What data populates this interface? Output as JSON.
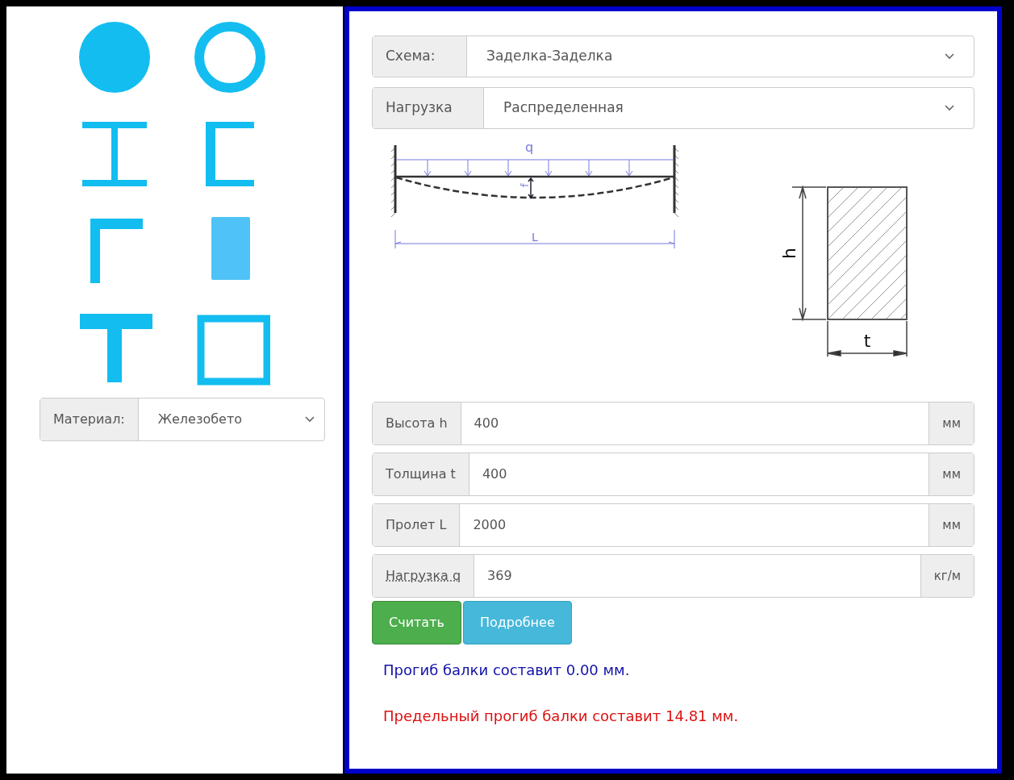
{
  "shapes": [
    {
      "kind": "circle",
      "selected": false
    },
    {
      "kind": "ring",
      "selected": false
    },
    {
      "kind": "i-beam",
      "selected": false
    },
    {
      "kind": "channel",
      "selected": false
    },
    {
      "kind": "angle",
      "selected": false
    },
    {
      "kind": "rectangle",
      "selected": true
    },
    {
      "kind": "tee",
      "selected": false
    },
    {
      "kind": "box",
      "selected": false
    }
  ],
  "material": {
    "label": "Материал:",
    "value": "Железобето"
  },
  "selects": [
    {
      "label": "Схема:",
      "value": "Заделка-Заделка"
    },
    {
      "label": "Нагрузка",
      "value": "Распределенная"
    }
  ],
  "beam_diagram": {
    "load": "q",
    "deflection": "f",
    "span": "L"
  },
  "section_diagram": {
    "height": "h",
    "thickness": "t"
  },
  "inputs": [
    {
      "label": "Высота h",
      "value": "400",
      "unit": "мм",
      "underlined": false
    },
    {
      "label": "Толщина t",
      "value": "400",
      "unit": "мм",
      "underlined": false
    },
    {
      "label": "Пролет L",
      "value": "2000",
      "unit": "мм",
      "underlined": false
    },
    {
      "label": "Нагрузка q",
      "value": "369",
      "unit": "кг/м",
      "underlined": true
    }
  ],
  "buttons": [
    {
      "label": "Считать",
      "kind": "primary"
    },
    {
      "label": "Подробнее",
      "kind": "info"
    }
  ],
  "results": [
    {
      "text": "Прогиб балки составит 0.00 мм.",
      "kind": "value"
    },
    {
      "text": "Предельный прогиб балки составит 14.81 мм.",
      "kind": "limit"
    }
  ]
}
